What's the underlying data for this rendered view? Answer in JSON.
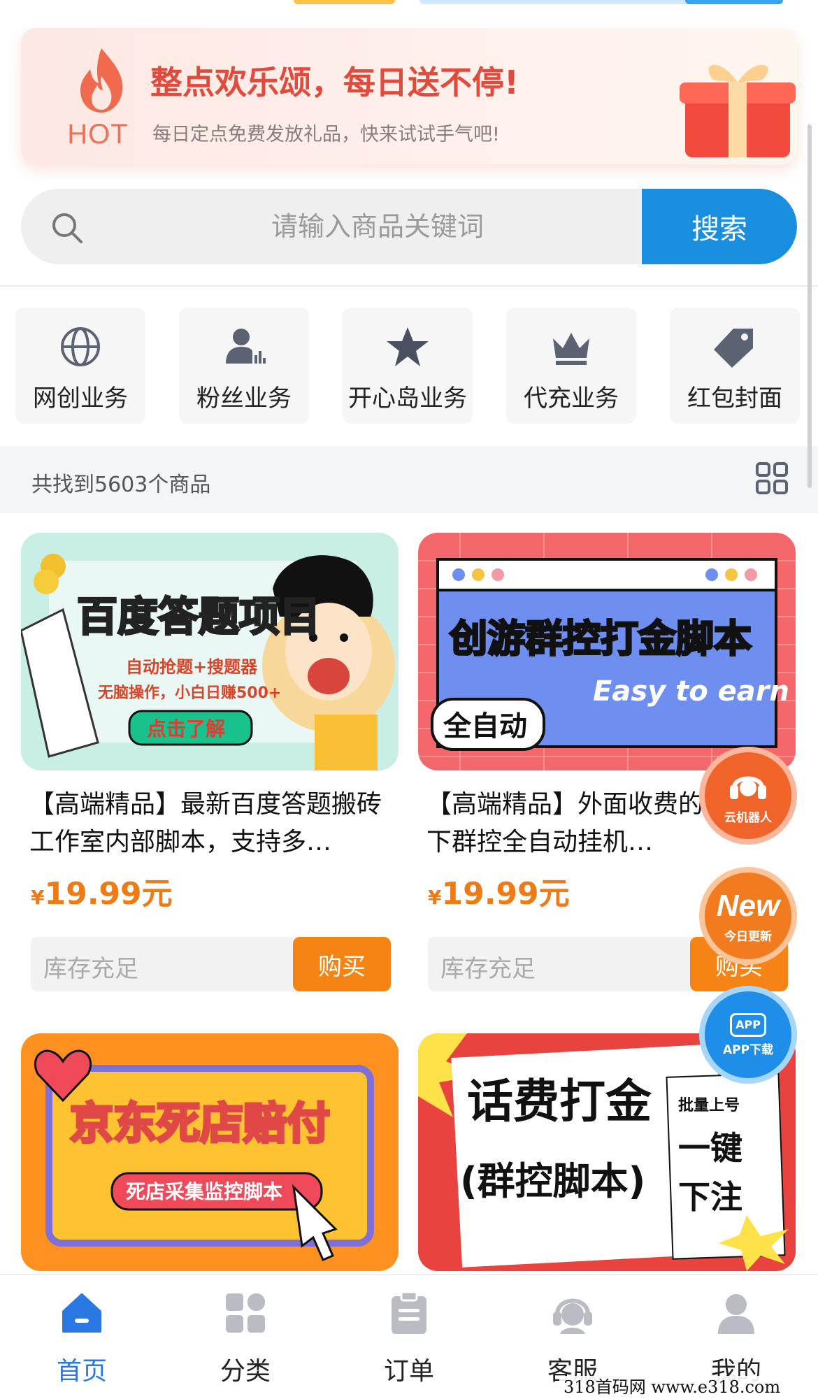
{
  "banner": {
    "logo_word": "HOT",
    "title": "整点欢乐颂，每日送不停!",
    "subtitle": "每日定点免费发放礼品，快来试试手气吧!"
  },
  "search": {
    "placeholder": "请输入商品关键词",
    "button_label": "搜索"
  },
  "categories": [
    {
      "label": "网创业务",
      "icon": "globe-icon"
    },
    {
      "label": "粉丝业务",
      "icon": "user-chart-icon"
    },
    {
      "label": "开心岛业务",
      "icon": "star-icon"
    },
    {
      "label": "代充业务",
      "icon": "crown-icon"
    },
    {
      "label": "红包封面",
      "icon": "tag-icon"
    }
  ],
  "results": {
    "count_text": "共找到5603个商品"
  },
  "products": [
    {
      "image_title": "百度答题项目",
      "image_line1": "自动抢题+搜题器",
      "image_line2": "无脑操作，小白日赚500+",
      "image_button": "点击了解",
      "title": "【高端精品】最新百度答题搬砖工作室内部脚本，支持多…",
      "currency": "¥",
      "price": "19.99元",
      "stock": "库存充足",
      "buy": "购买"
    },
    {
      "image_title": "创游群控打金脚本",
      "image_line1": "Easy to earn",
      "image_badge": "全自动",
      "title": "【高端精品】外面收费的创游天下群控全自动挂机…",
      "currency": "¥",
      "price": "19.99元",
      "stock": "库存充足",
      "buy": "购买"
    },
    {
      "image_title": "京东死店赔付",
      "image_line1": "死店采集监控脚本"
    },
    {
      "image_title": "话费打金",
      "image_line1": "(群控脚本)",
      "image_side1": "批量上号",
      "image_side2": "一键",
      "image_side3": "下注"
    }
  ],
  "floating": {
    "robot": "云机器人",
    "new_big": "New",
    "new_small": "今日更新",
    "app_big": "APP",
    "app_small": "APP下载"
  },
  "nav": [
    {
      "label": "首页",
      "icon": "home-icon",
      "active": true
    },
    {
      "label": "分类",
      "icon": "category-icon",
      "active": false
    },
    {
      "label": "订单",
      "icon": "order-icon",
      "active": false
    },
    {
      "label": "客服",
      "icon": "support-icon",
      "active": false
    },
    {
      "label": "我的",
      "icon": "user-icon",
      "active": false
    }
  ],
  "watermark": "318首码网  www.e318.com",
  "colors": {
    "accent_blue": "#1a8fe0",
    "price_orange": "#f07a14",
    "buy_orange": "#f58414",
    "hot_red": "#e24a3b",
    "nav_active": "#2a78e4"
  }
}
